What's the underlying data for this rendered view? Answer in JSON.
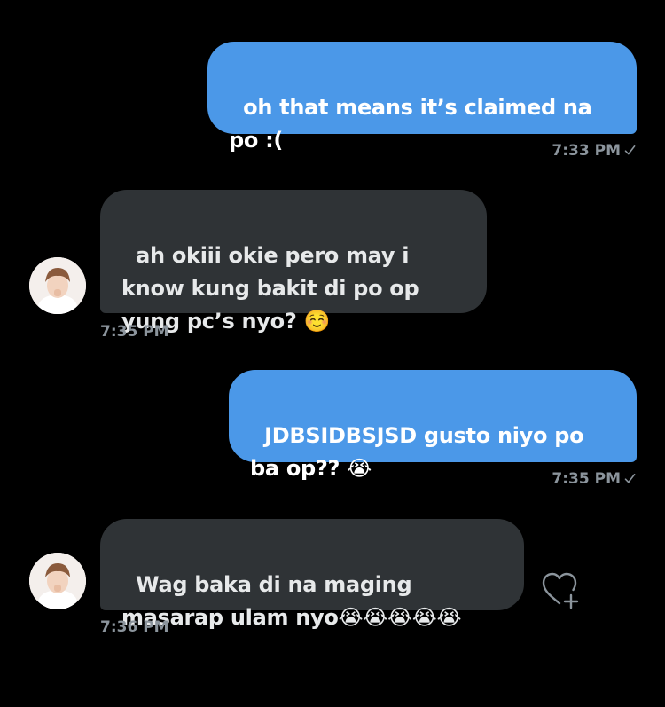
{
  "messages": [
    {
      "direction": "sent",
      "text": "oh that means it’s claimed na po :(",
      "time": "7:33 PM"
    },
    {
      "direction": "received",
      "text": "ah okiii okie pero may i know kung bakit di po op yung pc’s nyo? ☺️",
      "time": "7:35 PM"
    },
    {
      "direction": "sent",
      "text": "JDBSIDBSJSD gusto niyo po ba op?? 😭",
      "time": "7:35 PM"
    },
    {
      "direction": "received",
      "text": "Wag baka di na maging masarap ulam nyo😭😭😭😭😭",
      "time": "7:36 PM"
    }
  ],
  "icons": {
    "read_receipt": "checkmark-icon",
    "react": "heart-add-icon",
    "avatar": "user-avatar"
  },
  "colors": {
    "background": "#000000",
    "sent_bubble": "#4b98e8",
    "received_bubble": "#2f3336",
    "timestamp": "#8b949c"
  }
}
